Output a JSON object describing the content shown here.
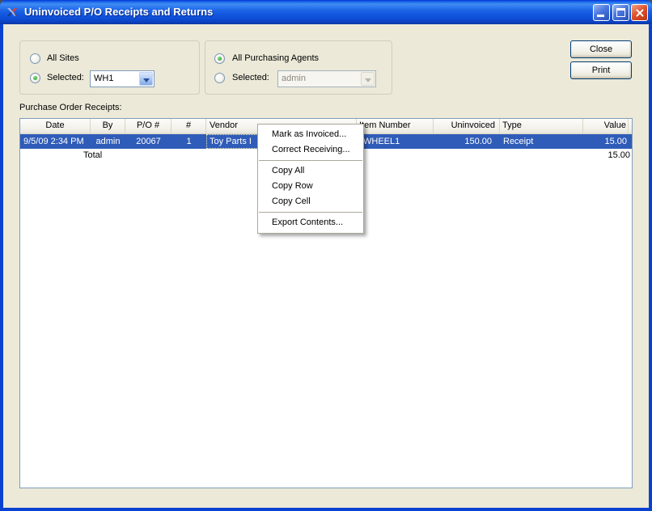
{
  "window": {
    "title": "Uninvoiced P/O Receipts and Returns"
  },
  "icons": {
    "app": "x-logo-icon",
    "minimize": "minimize-icon",
    "maximize": "maximize-icon",
    "close": "close-icon",
    "combo_arrow": "chevron-down-icon"
  },
  "filters": {
    "sites": {
      "all_label": "All Sites",
      "all_checked": false,
      "selected_label": "Selected:",
      "selected_checked": true,
      "selected_value": "WH1"
    },
    "agents": {
      "all_label": "All Purchasing Agents",
      "all_checked": true,
      "selected_label": "Selected:",
      "selected_checked": false,
      "selected_value": "admin",
      "selected_disabled": true
    }
  },
  "buttons": {
    "close": "Close",
    "print": "Print"
  },
  "grid": {
    "label": "Purchase Order Receipts:",
    "columns": [
      "Date",
      "By",
      "P/O #",
      "#",
      "Vendor",
      "Item Number",
      "Uninvoiced",
      "Type",
      "Value"
    ],
    "rows": [
      {
        "date": "9/5/09 2:34 PM",
        "by": "admin",
        "po": "20067",
        "num": "1",
        "vendor": "Toy Parts I",
        "item": "WHEEL1",
        "uninvoiced": "150.00",
        "type": "Receipt",
        "value": "15.00",
        "selected": true
      }
    ],
    "total_label": "Total",
    "total_value": "15.00"
  },
  "context_menu": {
    "items": [
      {
        "type": "item",
        "label": "Mark as Invoiced..."
      },
      {
        "type": "item",
        "label": "Correct Receiving..."
      },
      {
        "type": "separator"
      },
      {
        "type": "item",
        "label": "Copy All"
      },
      {
        "type": "item",
        "label": "Copy Row"
      },
      {
        "type": "item",
        "label": "Copy Cell"
      },
      {
        "type": "separator"
      },
      {
        "type": "item",
        "label": "Export Contents..."
      }
    ]
  },
  "colors": {
    "titlebar_main": "#1257DF",
    "window_border": "#0A41D1",
    "dialog_bg": "#ECE9D8",
    "selection_blue": "#2F5CB8",
    "grid_border": "#7F9DB9",
    "menu_border": "#ACA899",
    "close_button_red": "#DD4F28",
    "radio_check_green": "#2F9E2F"
  }
}
